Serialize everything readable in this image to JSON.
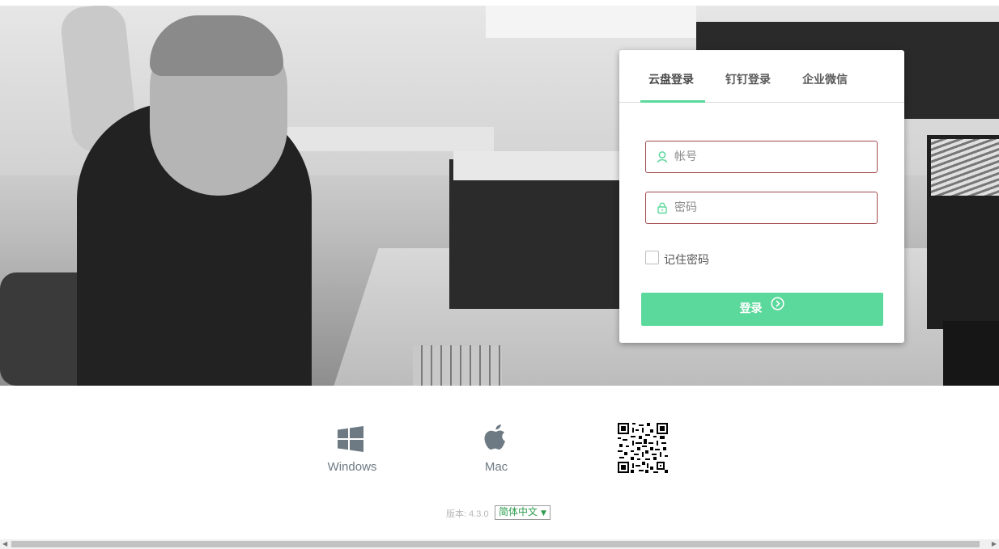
{
  "login": {
    "tabs": [
      {
        "label": "云盘登录"
      },
      {
        "label": "钉钉登录"
      },
      {
        "label": "企业微信"
      }
    ],
    "username_placeholder": "帐号",
    "password_placeholder": "密码",
    "remember_label": "记住密码",
    "submit_label": "登录"
  },
  "downloads": {
    "windows_label": "Windows",
    "mac_label": "Mac"
  },
  "footer": {
    "version_text": "版本: 4.3.0",
    "language_selected": "简体中文"
  },
  "colors": {
    "accent": "#5bd89b",
    "field_border": "#a34a4f",
    "download_icon": "#6d7a83"
  },
  "icons": [
    "user-icon",
    "lock-icon",
    "arrow-right-circle-icon",
    "windows-icon",
    "apple-icon",
    "qr-code"
  ]
}
